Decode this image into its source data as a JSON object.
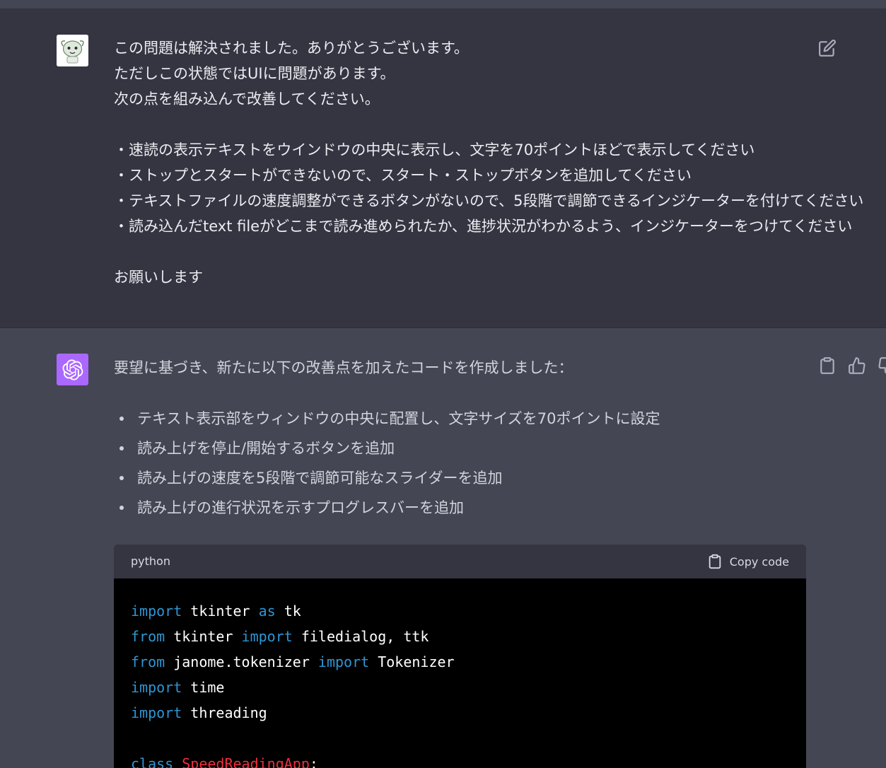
{
  "user_message": {
    "lines": [
      "この問題は解決されました。ありがとうございます。",
      "ただしこの状態ではUIに問題があります。",
      "次の点を組み込んで改善してください。",
      "",
      "・速読の表示テキストをウインドウの中央に表示し、文字を70ポイントほどで表示してください",
      "・ストップとスタートができないので、スタート・ストップボタンを追加してください",
      "・テキストファイルの速度調整ができるボタンがないので、5段階で調節できるインジケーターを付けてください",
      "・読み込んだtext fileがどこまで読み進められたか、進捗状況がわかるよう、インジケーターをつけてください",
      "",
      "お願いします"
    ]
  },
  "assistant_message": {
    "intro": "要望に基づき、新たに以下の改善点を加えたコードを作成しました：",
    "bullets": [
      "テキスト表示部をウィンドウの中央に配置し、文字サイズを70ポイントに設定",
      "読み上げを停止/開始するボタンを追加",
      "読み上げの速度を5段階で調節可能なスライダーを追加",
      "読み上げの進行状況を示すプログレスバーを追加"
    ],
    "code_block": {
      "language": "python",
      "copy_label": "Copy code",
      "lines": [
        [
          {
            "t": "import",
            "c": "kw"
          },
          {
            "t": " tkinter ",
            "c": "plain"
          },
          {
            "t": "as",
            "c": "kw"
          },
          {
            "t": " tk",
            "c": "plain"
          }
        ],
        [
          {
            "t": "from",
            "c": "kw"
          },
          {
            "t": " tkinter ",
            "c": "plain"
          },
          {
            "t": "import",
            "c": "kw"
          },
          {
            "t": " filedialog, ttk",
            "c": "plain"
          }
        ],
        [
          {
            "t": "from",
            "c": "kw"
          },
          {
            "t": " janome.tokenizer ",
            "c": "plain"
          },
          {
            "t": "import",
            "c": "kw"
          },
          {
            "t": " Tokenizer",
            "c": "plain"
          }
        ],
        [
          {
            "t": "import",
            "c": "kw"
          },
          {
            "t": " time",
            "c": "plain"
          }
        ],
        [
          {
            "t": "import",
            "c": "kw"
          },
          {
            "t": " threading",
            "c": "plain"
          }
        ],
        [],
        [
          {
            "t": "class",
            "c": "kw"
          },
          {
            "t": " ",
            "c": "plain"
          },
          {
            "t": "SpeedReadingApp",
            "c": "cls"
          },
          {
            "t": ":",
            "c": "plain"
          }
        ]
      ]
    }
  },
  "colors": {
    "user_bg": "#343541",
    "assistant_bg": "#444654",
    "ai_avatar": "#ab68ff",
    "code_keyword": "#2e95d3",
    "code_class": "#f22c3d"
  },
  "icons": {
    "edit": "edit-icon",
    "copy": "clipboard-icon",
    "thumbs_up": "thumbs-up-icon",
    "thumbs_down": "thumbs-down-icon",
    "ai_logo": "openai-logo-icon",
    "user_avatar": "user-avatar-icon"
  }
}
